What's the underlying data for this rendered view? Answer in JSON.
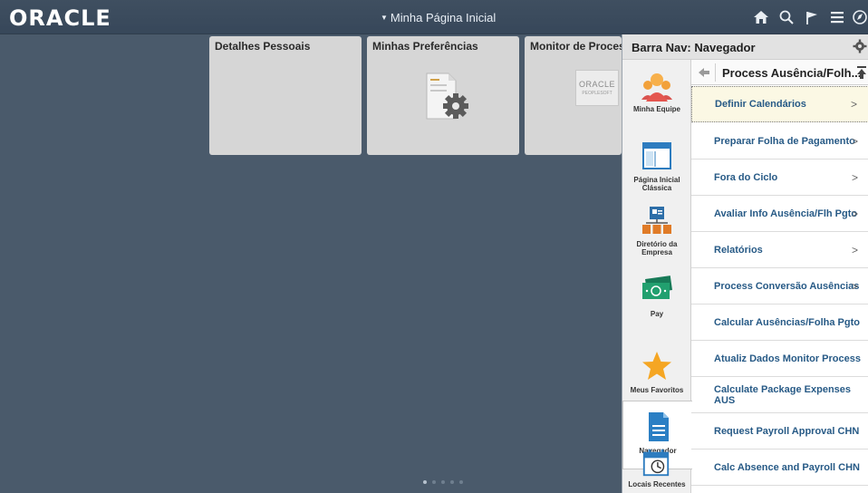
{
  "banner": {
    "logo": "ORACLE",
    "page_title": "Minha Página Inicial",
    "icons": [
      "home-icon",
      "search-icon",
      "flag-icon",
      "menu-icon",
      "navbar-icon"
    ]
  },
  "tiles": [
    {
      "title": "Detalhes Pessoais"
    },
    {
      "title": "Minhas Preferências"
    },
    {
      "title": "Monitor de Processos",
      "logo_line1": "ORACLE",
      "logo_line2": "PEOPLESOFT"
    }
  ],
  "nav": {
    "title": "Barra Nav: Navegador",
    "side": [
      {
        "label": "Minha Equipe",
        "icon": "team-icon"
      },
      {
        "label": "Página Inicial Clássica",
        "icon": "classic-home-icon"
      },
      {
        "label": "Diretório da Empresa",
        "icon": "directory-icon"
      },
      {
        "label": "Pay",
        "icon": "pay-icon"
      },
      {
        "label": "Meus Favoritos",
        "icon": "star-icon"
      },
      {
        "label": "Navegador",
        "icon": "navigator-icon"
      },
      {
        "label": "Locais Recentes",
        "icon": "recent-places-icon"
      }
    ],
    "list_header": "Process Ausência/Folh...",
    "items": [
      {
        "label": "Definir Calendários",
        "chevron": ">"
      },
      {
        "label": "Preparar Folha de Pagamento",
        "chevron": ">"
      },
      {
        "label": "Fora do Ciclo",
        "chevron": ">"
      },
      {
        "label": "Avaliar Info Ausência/Flh Pgto",
        "chevron": ">"
      },
      {
        "label": "Relatórios",
        "chevron": ">"
      },
      {
        "label": "Process Conversão Ausências",
        "chevron": ">"
      },
      {
        "label": "Calcular Ausências/Folha Pgto",
        "chevron": ""
      },
      {
        "label": "Atualiz Dados Monitor Process",
        "chevron": ""
      },
      {
        "label": "Calculate Package Expenses AUS",
        "chevron": ""
      },
      {
        "label": "Request Payroll Approval CHN",
        "chevron": ""
      },
      {
        "label": "Calc Absence and Payroll CHN",
        "chevron": ""
      }
    ]
  },
  "colors": {
    "banner": "#3f4f60",
    "background": "#4a5a6b",
    "link": "#275a86",
    "selected": "#fbf8e4"
  }
}
